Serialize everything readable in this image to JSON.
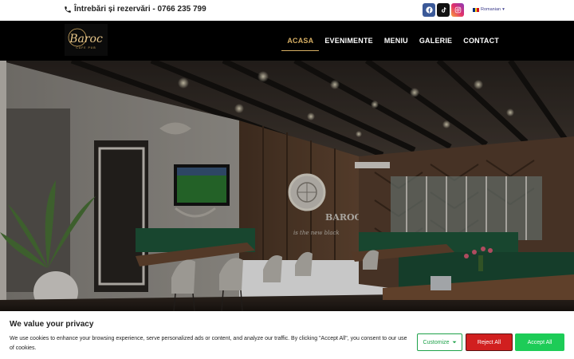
{
  "topbar": {
    "phone_text": "Întrebări și rezervări - 0766 235 799",
    "language": "Romanian",
    "language_caret": "▾",
    "socials": [
      "facebook-icon",
      "tiktok-icon",
      "instagram-icon"
    ]
  },
  "navbar": {
    "logo_text": "Baroc",
    "logo_subtext": "CAFE PUB",
    "items": [
      {
        "label": "ACASA",
        "active": true
      },
      {
        "label": "EVENIMENTE",
        "active": false
      },
      {
        "label": "MENIU",
        "active": false
      },
      {
        "label": "GALERIE",
        "active": false
      },
      {
        "label": "CONTACT",
        "active": false
      }
    ]
  },
  "hero": {
    "sign_text": "BAROC",
    "sign_subtext": "is the new black"
  },
  "cookie": {
    "title": "We value your privacy",
    "text": "We use cookies to enhance your browsing experience, serve personalized ads or content, and analyze our traffic. By clicking \"Accept All\", you consent to our use of cookies.",
    "customize_label": "Customize",
    "reject_label": "Reject All",
    "accept_label": "Accept All"
  },
  "colors": {
    "accent_gold": "#d6ae63",
    "accept_green": "#1dcc57",
    "reject_red": "#d11f1f",
    "nav_bg": "#000000"
  }
}
